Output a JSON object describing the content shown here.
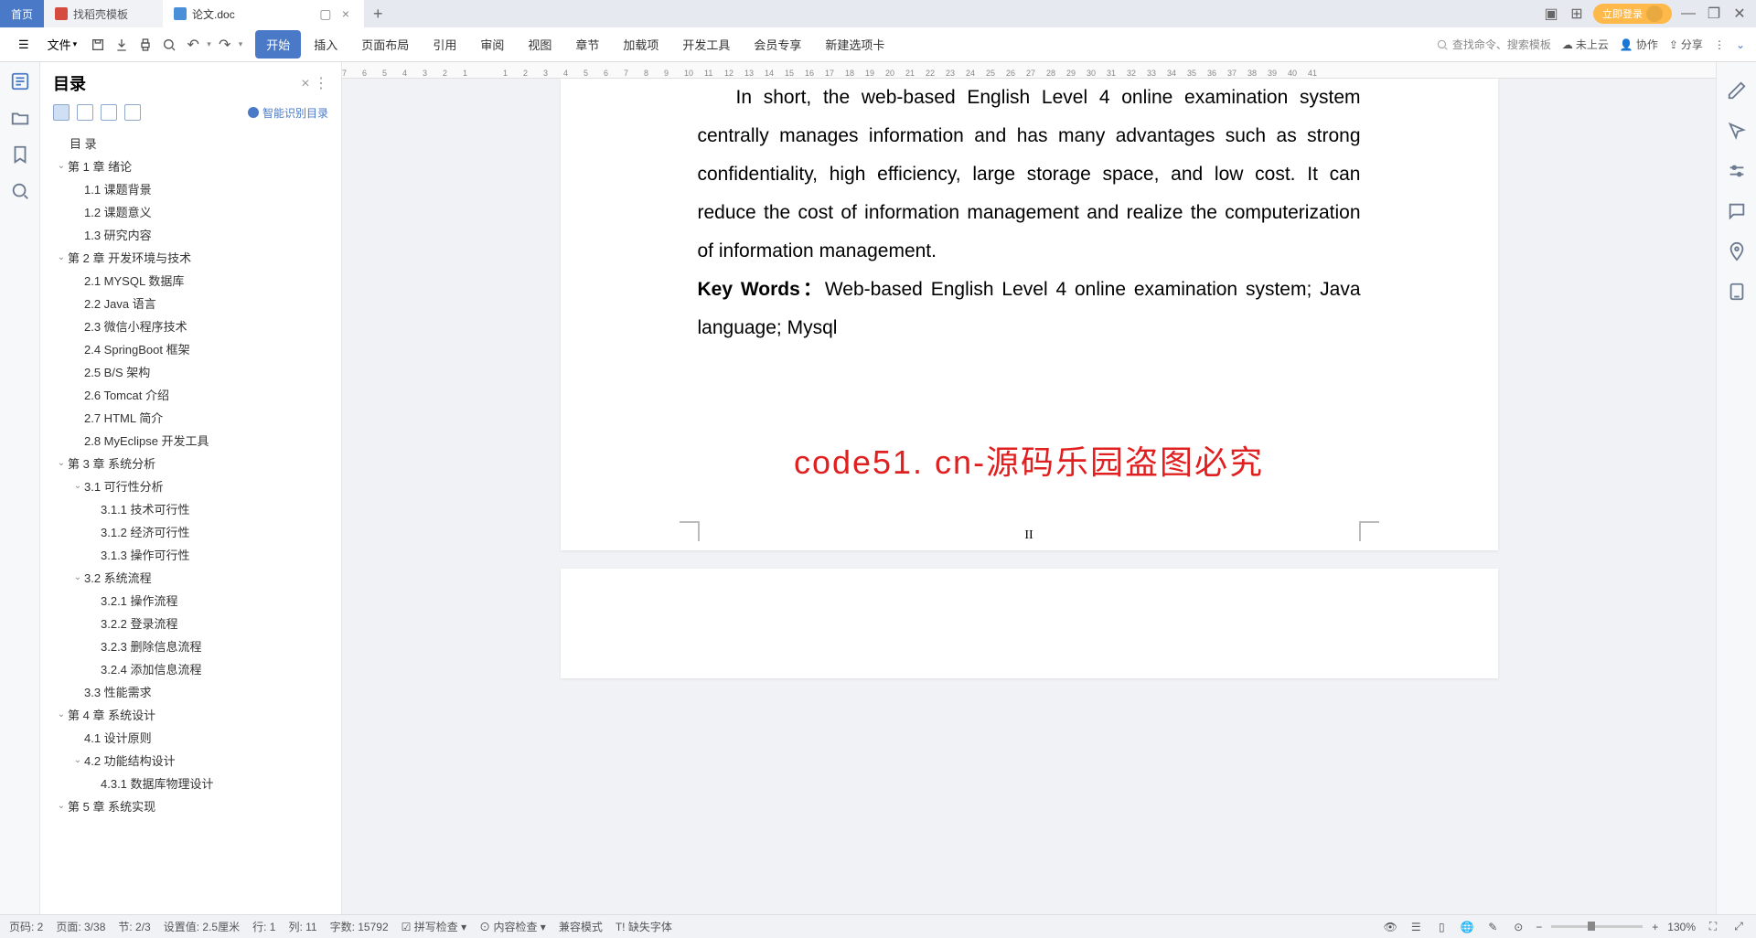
{
  "tabs": {
    "home": "首页",
    "docao": "找稻壳模板",
    "active": "论文.doc"
  },
  "login": "立即登录",
  "file_menu": "文件",
  "ribbon": {
    "start": "开始",
    "insert": "插入",
    "layout": "页面布局",
    "ref": "引用",
    "review": "审阅",
    "view": "视图",
    "chapter": "章节",
    "addon": "加载项",
    "dev": "开发工具",
    "member": "会员专享",
    "newtab": "新建选项卡"
  },
  "search_placeholder": "查找命令、搜索模板",
  "cloud": "未上云",
  "collab": "协作",
  "share": "分享",
  "outline": {
    "title": "目录",
    "smart": "智能识别目录",
    "root": "目  录",
    "items": [
      {
        "t": "第 1 章  绪论",
        "l": 0,
        "c": 1
      },
      {
        "t": "1.1  课题背景",
        "l": 1
      },
      {
        "t": "1.2  课题意义",
        "l": 1
      },
      {
        "t": "1.3  研究内容",
        "l": 1
      },
      {
        "t": "第 2 章  开发环境与技术",
        "l": 0,
        "c": 1
      },
      {
        "t": "2.1  MYSQL 数据库",
        "l": 1
      },
      {
        "t": "2.2  Java 语言",
        "l": 1
      },
      {
        "t": "2.3  微信小程序技术",
        "l": 1
      },
      {
        "t": "2.4  SpringBoot 框架",
        "l": 1
      },
      {
        "t": "2.5  B/S 架构",
        "l": 1
      },
      {
        "t": "2.6  Tomcat  介绍",
        "l": 1
      },
      {
        "t": "2.7  HTML 简介",
        "l": 1
      },
      {
        "t": "2.8  MyEclipse 开发工具",
        "l": 1
      },
      {
        "t": "第 3 章  系统分析",
        "l": 0,
        "c": 1
      },
      {
        "t": "3.1  可行性分析",
        "l": 1,
        "c": 1
      },
      {
        "t": "3.1.1  技术可行性",
        "l": 2
      },
      {
        "t": "3.1.2  经济可行性",
        "l": 2
      },
      {
        "t": "3.1.3  操作可行性",
        "l": 2
      },
      {
        "t": "3.2  系统流程",
        "l": 1,
        "c": 1
      },
      {
        "t": "3.2.1  操作流程",
        "l": 2
      },
      {
        "t": "3.2.2  登录流程",
        "l": 2
      },
      {
        "t": "3.2.3  删除信息流程",
        "l": 2
      },
      {
        "t": "3.2.4  添加信息流程",
        "l": 2
      },
      {
        "t": "3.3  性能需求",
        "l": 1
      },
      {
        "t": "第 4 章  系统设计",
        "l": 0,
        "c": 1
      },
      {
        "t": "4.1  设计原则",
        "l": 1
      },
      {
        "t": "4.2  功能结构设计",
        "l": 1,
        "c": 1
      },
      {
        "t": "4.3.1  数据库物理设计",
        "l": 2
      },
      {
        "t": "第 5 章  系统实现",
        "l": 0,
        "c": 1
      }
    ]
  },
  "doc": {
    "para1": "In short, the web-based English Level 4 online examination system centrally manages information and has many advantages such as strong confidentiality, high efficiency, large storage space, and low cost. It can reduce the cost of information management and realize the computerization of information management.",
    "kw_label": "Key Words：",
    "kw_text": "Web-based English Level 4 online examination system; Java language; Mysql",
    "watermark": "code51. cn-源码乐园盗图必究",
    "page_num": "II"
  },
  "status": {
    "page_code": "页码: 2",
    "page": "页面: 3/38",
    "section": "节: 2/3",
    "setval": "设置值: 2.5厘米",
    "row": "行: 1",
    "col": "列: 11",
    "words": "字数: 15792",
    "spell": "拼写检查",
    "content": "内容检查",
    "compat": "兼容模式",
    "font": "缺失字体",
    "zoom": "130%"
  }
}
